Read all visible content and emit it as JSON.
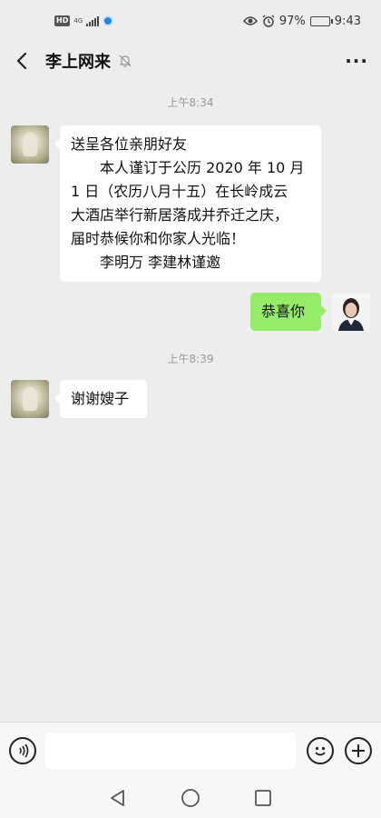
{
  "status_bar": {
    "hd": "HD",
    "net_type": "4G",
    "battery_percent": "97%",
    "battery_level": 0.97,
    "time": "9:43",
    "icons": [
      "hd-badge",
      "signal-icon",
      "app-dot-icon",
      "eye-icon",
      "alarm-icon",
      "battery-icon"
    ]
  },
  "header": {
    "title": "李上网来",
    "icons": [
      "back-icon",
      "mute-bell-icon",
      "more-icon"
    ]
  },
  "messages": [
    {
      "type": "timestamp",
      "text": "上午8:34"
    },
    {
      "type": "incoming",
      "lines": [
        "送呈各位亲朋好友",
        "本人谨订于公历 2020 年 10 月",
        "1 日（农历八月十五）在长岭成云",
        "大酒店举行新居落成并乔迁之庆，",
        "届时恭候你和你家人光临！",
        "李明万 李建林谨邀"
      ]
    },
    {
      "type": "outgoing",
      "text": "恭喜你"
    },
    {
      "type": "timestamp",
      "text": "上午8:39"
    },
    {
      "type": "incoming",
      "text": "谢谢嫂子"
    }
  ],
  "input_bar": {
    "value": "",
    "icons": [
      "voice-icon",
      "emoji-icon",
      "plus-icon"
    ]
  },
  "nav_bar": {
    "icons": [
      "nav-back-icon",
      "nav-home-icon",
      "nav-recents-icon"
    ]
  },
  "colors": {
    "background": "#ededed",
    "outgoing_bubble": "#95ec69",
    "incoming_bubble": "#ffffff",
    "timestamp_text": "#999999"
  }
}
